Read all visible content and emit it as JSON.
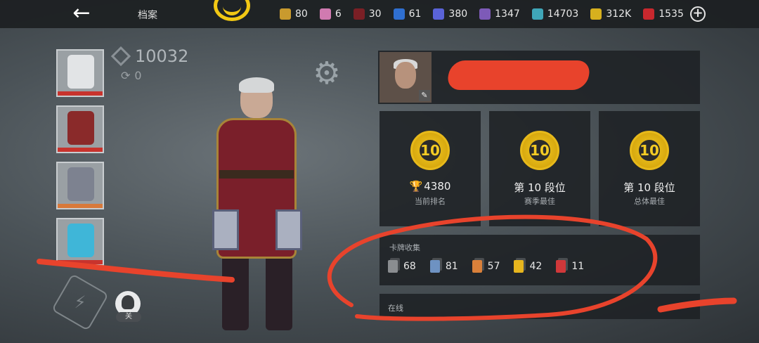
{
  "header": {
    "title": "档案",
    "resources": [
      {
        "icon": "gold-coin-icon",
        "value": "80",
        "color": "#c99a2e"
      },
      {
        "icon": "pink-ticket-icon",
        "value": "6",
        "color": "#d07ab0"
      },
      {
        "icon": "red-card-icon",
        "value": "30",
        "color": "#7a1f25"
      },
      {
        "icon": "blue-card-icon",
        "value": "61",
        "color": "#2f6fd0"
      },
      {
        "icon": "blue-star-icon",
        "value": "380",
        "color": "#5a63d8"
      },
      {
        "icon": "purple-diamond-icon",
        "value": "1347",
        "color": "#7d5ab8"
      },
      {
        "icon": "teal-orb-icon",
        "value": "14703",
        "color": "#3fa6b8"
      },
      {
        "icon": "gold-ring-icon",
        "value": "312K",
        "color": "#d7b01e"
      },
      {
        "icon": "ruby-icon",
        "value": "1535",
        "color": "#c8282e"
      }
    ]
  },
  "equipment": {
    "slots": [
      {
        "name": "helmet",
        "bar_color": "#c8332d",
        "art_color": "#e2e4e6"
      },
      {
        "name": "armor",
        "bar_color": "#c8332d",
        "art_color": "#8a2a2a"
      },
      {
        "name": "hammers",
        "bar_color": "#d8793a",
        "art_color": "#7d8290"
      },
      {
        "name": "blades",
        "bar_color": "#c8332d",
        "art_color": "#3fb6d8"
      }
    ]
  },
  "power": {
    "value": "10032",
    "sub_value": "0"
  },
  "toggle": {
    "label": "关"
  },
  "ranks": [
    {
      "badge": "10",
      "main": "4380",
      "sub": "当前排名",
      "trophy": true
    },
    {
      "badge": "10",
      "main": "第 10 段位",
      "sub": "赛季最佳",
      "trophy": false
    },
    {
      "badge": "10",
      "main": "第 10 段位",
      "sub": "总体最佳",
      "trophy": false
    }
  ],
  "collection": {
    "title": "卡牌收集",
    "cards": [
      {
        "value": "68",
        "color": "#8a8d90"
      },
      {
        "value": "81",
        "color": "#6e92c2"
      },
      {
        "value": "57",
        "color": "#d9803a"
      },
      {
        "value": "42",
        "color": "#e6b51e"
      },
      {
        "value": "11",
        "color": "#d0383a"
      }
    ]
  },
  "status": {
    "label": "在线"
  }
}
